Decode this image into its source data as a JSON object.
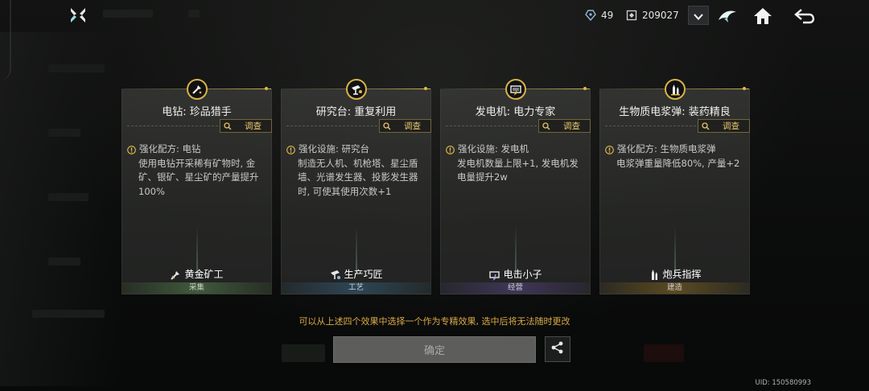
{
  "topbar": {
    "resource_a": "49",
    "resource_b": "209027",
    "icons": [
      "logo-icon",
      "gem-icon",
      "crate-icon",
      "chevron-down-icon",
      "shark-icon",
      "home-icon",
      "back-icon"
    ]
  },
  "cards": [
    {
      "title": "电钻: 珍品猎手",
      "investigate": "调查",
      "head": "强化配方: 电钻",
      "body": "使用电钻开采稀有矿物时, 金矿、银矿、星尘矿的产量提升100%",
      "role": "黄金矿工",
      "category": "采集",
      "category_color": "#3f5a3a"
    },
    {
      "title": "研究台: 重复利用",
      "investigate": "调查",
      "head": "强化设施: 研究台",
      "body": "制造无人机、机枪塔、星尘盾墙、光谱发生器、投影发生器时, 可使其使用次数+1",
      "role": "生产巧匠",
      "category": "工艺",
      "category_color": "#2d4656"
    },
    {
      "title": "发电机: 电力专家",
      "investigate": "调查",
      "head": "强化设施: 发电机",
      "body": "发电机数量上限+1, 发电机发电量提升2w",
      "role": "电击小子",
      "category": "经营",
      "category_color": "#3f3658"
    },
    {
      "title": "生物质电浆弹: 装药精良",
      "investigate": "调查",
      "head": "强化配方: 生物质电浆弹",
      "body": "电浆弹重量降低80%, 产量+2",
      "role": "炮兵指挥",
      "category": "建造",
      "category_color": "#5a4a22"
    }
  ],
  "notice": "可以从上述四个效果中选择一个作为专精效果, 选中后将无法随时更改",
  "confirm_label": "确定",
  "uid": "UID: 150580993",
  "accent": "#d8b24a"
}
